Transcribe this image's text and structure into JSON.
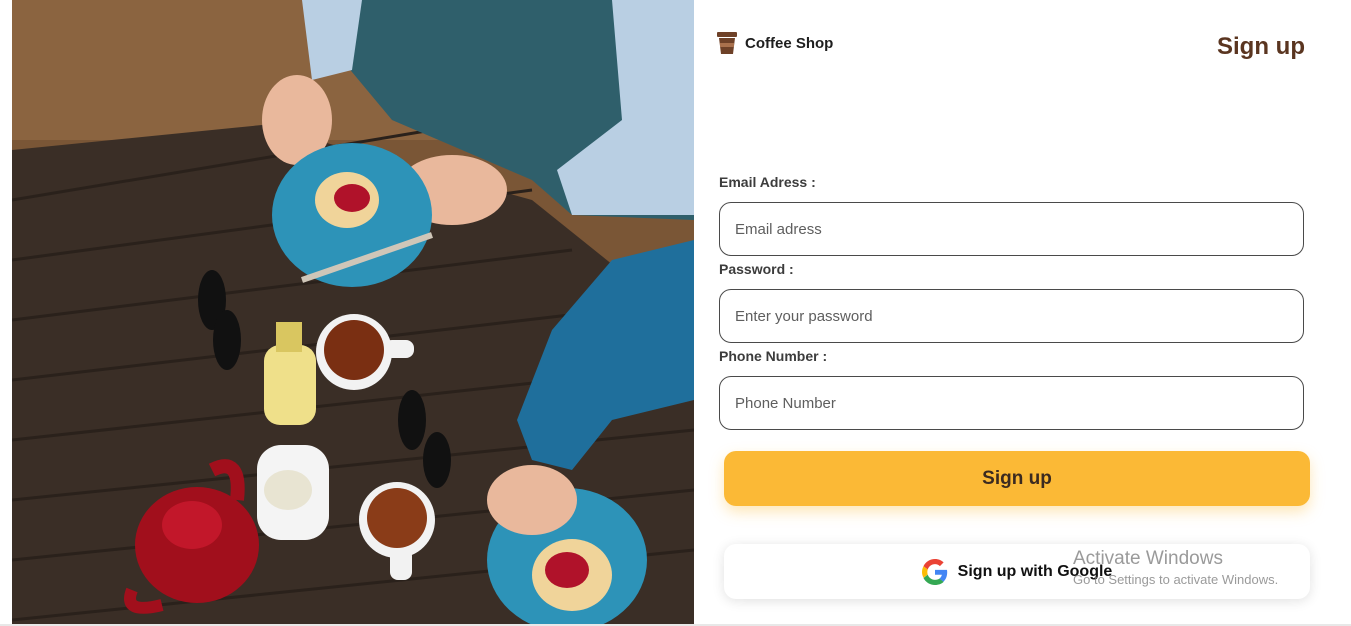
{
  "brand": {
    "name": "Coffee Shop",
    "icon": "coffee-cup-icon"
  },
  "page_title": "Sign up",
  "form": {
    "email": {
      "label": "Email Adress :",
      "placeholder": "Email adress",
      "value": ""
    },
    "password": {
      "label": "Password :",
      "placeholder": "Enter your password",
      "value": ""
    },
    "phone": {
      "label": "Phone Number :",
      "placeholder": "Phone Number",
      "value": ""
    },
    "submit_label": "Sign up",
    "google_label": "Sign up with Google",
    "google_icon": "google-g-icon"
  },
  "watermark": {
    "title": "Activate Windows",
    "subtitle": "Go to Settings to activate Windows."
  },
  "colors": {
    "accent": "#fbb936",
    "title": "#5a3520",
    "input_border": "#4a4a4a"
  }
}
